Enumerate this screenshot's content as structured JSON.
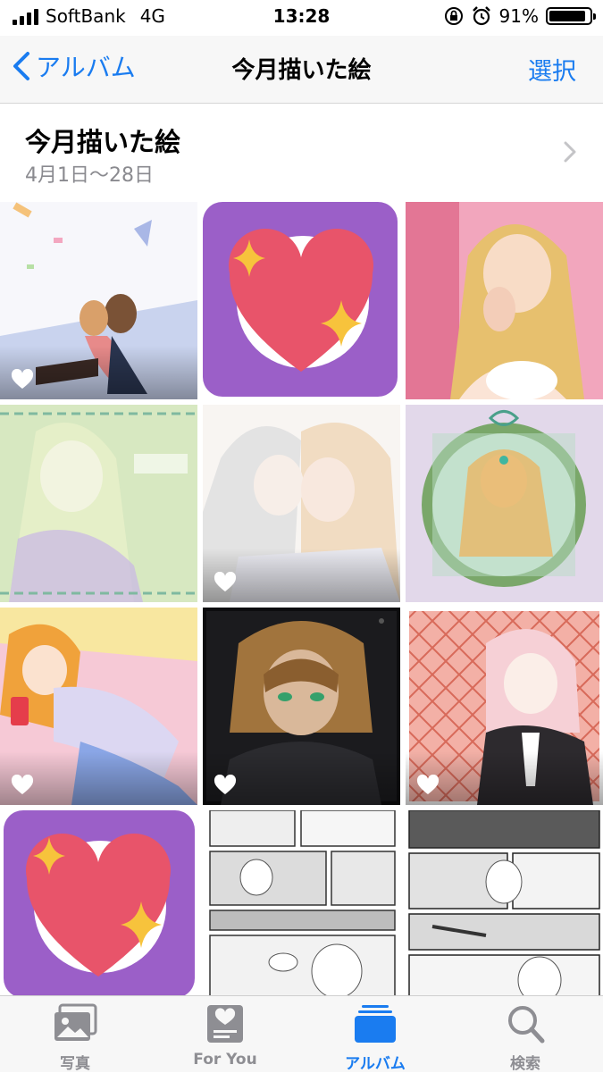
{
  "status_bar": {
    "carrier": "SoftBank",
    "network": "4G",
    "time": "13:28",
    "battery_percent": "91%",
    "battery_level": 0.91
  },
  "nav": {
    "back_label": "アルバム",
    "title": "今月描いた絵",
    "select_label": "選択"
  },
  "album": {
    "title": "今月描いた絵",
    "date_range": "4月1日〜28日"
  },
  "photos": [
    {
      "favorite": true,
      "kind": "illustration"
    },
    {
      "favorite": false,
      "kind": "heart-app-icon"
    },
    {
      "favorite": false,
      "kind": "illustration"
    },
    {
      "favorite": false,
      "kind": "illustration"
    },
    {
      "favorite": true,
      "kind": "illustration"
    },
    {
      "favorite": false,
      "kind": "illustration"
    },
    {
      "favorite": true,
      "kind": "illustration"
    },
    {
      "favorite": true,
      "kind": "illustration"
    },
    {
      "favorite": true,
      "kind": "illustration"
    },
    {
      "favorite": false,
      "kind": "heart-app-icon"
    },
    {
      "favorite": false,
      "kind": "manga-page"
    },
    {
      "favorite": false,
      "kind": "manga-page"
    }
  ],
  "tabs": [
    {
      "label": "写真",
      "icon": "photos-icon",
      "active": false
    },
    {
      "label": "For You",
      "icon": "for-you-icon",
      "active": false
    },
    {
      "label": "アルバム",
      "icon": "albums-icon",
      "active": true
    },
    {
      "label": "検索",
      "icon": "search-icon",
      "active": false
    }
  ],
  "colors": {
    "accent": "#1a7cf0",
    "tab_inactive": "#8e8e93",
    "heart_icon_bg": "#9b5fc8",
    "heart_red": "#e8546a",
    "sparkle_yellow": "#f7c33c"
  }
}
